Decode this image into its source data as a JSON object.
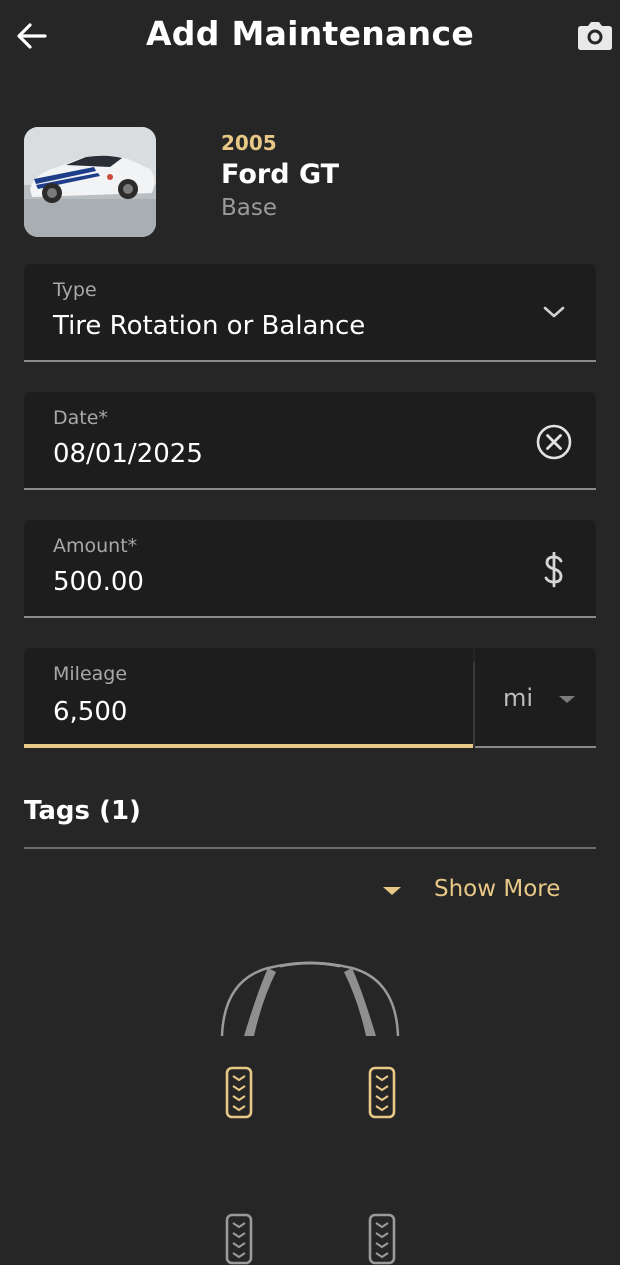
{
  "header": {
    "title": "Add Maintenance",
    "back_icon": "arrow-left-icon",
    "camera_icon": "camera-icon"
  },
  "vehicle": {
    "year": "2005",
    "model": "Ford GT",
    "trim": "Base"
  },
  "form": {
    "type": {
      "label": "Type",
      "value": "Tire Rotation or Balance",
      "icon": "chevron-down-icon"
    },
    "date": {
      "label": "Date*",
      "value": "08/01/2025",
      "icon": "clear-circle-icon"
    },
    "amount": {
      "label": "Amount*",
      "value": "500.00",
      "icon": "dollar-icon"
    },
    "mileage": {
      "label": "Mileage",
      "value": "6,500",
      "unit": "mi"
    }
  },
  "tags": {
    "title": "Tags (1)",
    "show_more": "Show More"
  },
  "tire_diagram": {
    "tires": [
      {
        "name": "front-left",
        "selected": true
      },
      {
        "name": "front-right",
        "selected": true
      },
      {
        "name": "rear-left",
        "selected": false
      },
      {
        "name": "rear-right",
        "selected": false
      }
    ]
  },
  "colors": {
    "background": "#262626",
    "field_bg": "#1d1d1d",
    "accent": "#e8c887",
    "muted_text": "#a8a8a8",
    "tire_unselected": "#9a9a9a"
  }
}
